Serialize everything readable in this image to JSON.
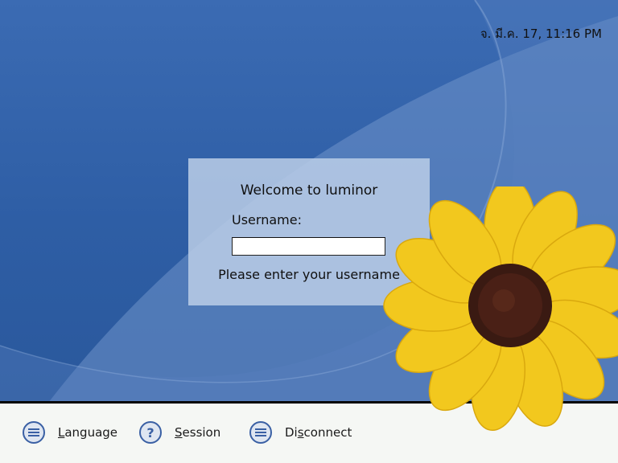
{
  "login": {
    "welcome": "Welcome to luminor",
    "username_label": "Username:",
    "username_value": "",
    "prompt": "Please enter your username"
  },
  "taskbar": {
    "language": {
      "mnemonic": "L",
      "rest": "anguage",
      "icon": "menu-icon"
    },
    "session": {
      "mnemonic": "S",
      "rest": "ession",
      "icon": "help-icon"
    },
    "disconnect": {
      "pre": "Di",
      "mnemonic": "s",
      "rest": "connect",
      "icon": "menu-icon"
    }
  },
  "clock": "จ. มี.ค. 17, 11:16 PM",
  "colors": {
    "desktop_blue": "#2f5fa6",
    "panel": "#bacde6",
    "icon_ring": "#3a60a4",
    "taskbar": "#f5f7f4",
    "petal": "#f2c81e",
    "flower_center": "#3a1a12"
  }
}
